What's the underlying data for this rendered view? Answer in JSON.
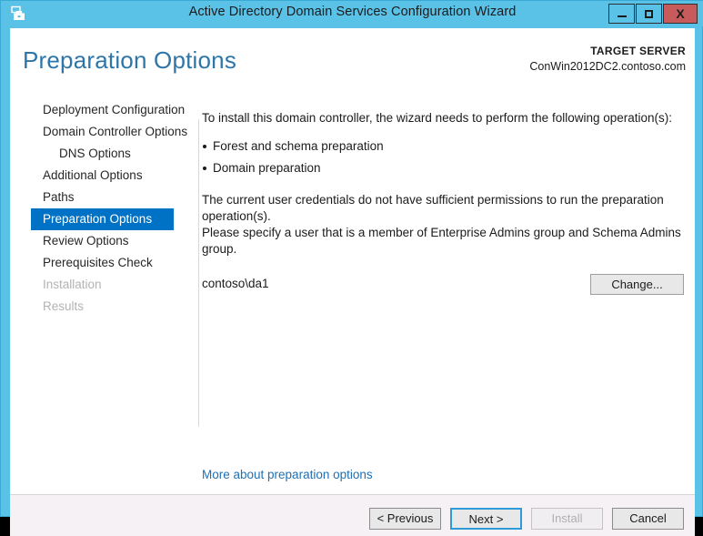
{
  "window": {
    "title": "Active Directory Domain Services Configuration Wizard",
    "icon": "server-manager-icon",
    "controls": {
      "minimize": "minimize-icon",
      "maximize": "maximize-icon",
      "close": "X"
    },
    "frame_color": "#5BC2E7",
    "close_color": "#C75B5B"
  },
  "header": {
    "page_title": "Preparation Options",
    "target_label": "TARGET SERVER",
    "target_server": "ConWin2012DC2.contoso.com",
    "title_color": "#2E75A8"
  },
  "sidebar": {
    "selected_color": "#0072C6",
    "items": [
      {
        "label": "Deployment Configuration",
        "state": "enabled",
        "indent": false
      },
      {
        "label": "Domain Controller Options",
        "state": "enabled",
        "indent": false
      },
      {
        "label": "DNS Options",
        "state": "enabled",
        "indent": true
      },
      {
        "label": "Additional Options",
        "state": "enabled",
        "indent": false
      },
      {
        "label": "Paths",
        "state": "enabled",
        "indent": false
      },
      {
        "label": "Preparation Options",
        "state": "selected",
        "indent": true
      },
      {
        "label": "Review Options",
        "state": "enabled",
        "indent": false
      },
      {
        "label": "Prerequisites Check",
        "state": "enabled",
        "indent": false
      },
      {
        "label": "Installation",
        "state": "disabled",
        "indent": false
      },
      {
        "label": "Results",
        "state": "disabled",
        "indent": false
      }
    ]
  },
  "main": {
    "intro": "To install this domain controller, the wizard needs to perform the following operation(s):",
    "operations": [
      "Forest and schema preparation",
      "Domain preparation"
    ],
    "warning_line1": "The current user credentials do not have sufficient permissions to run the preparation operation(s).",
    "warning_line2": "Please specify a user that is a member of Enterprise Admins group and Schema Admins group.",
    "credential_user": "contoso\\da1",
    "change_button": "Change...",
    "more_link": "More about preparation options",
    "link_color": "#1F6FB2"
  },
  "footer": {
    "buttons": [
      {
        "label": "< Previous",
        "state": "enabled"
      },
      {
        "label": "Next >",
        "state": "default"
      },
      {
        "label": "Install",
        "state": "disabled"
      },
      {
        "label": "Cancel",
        "state": "enabled"
      }
    ]
  }
}
